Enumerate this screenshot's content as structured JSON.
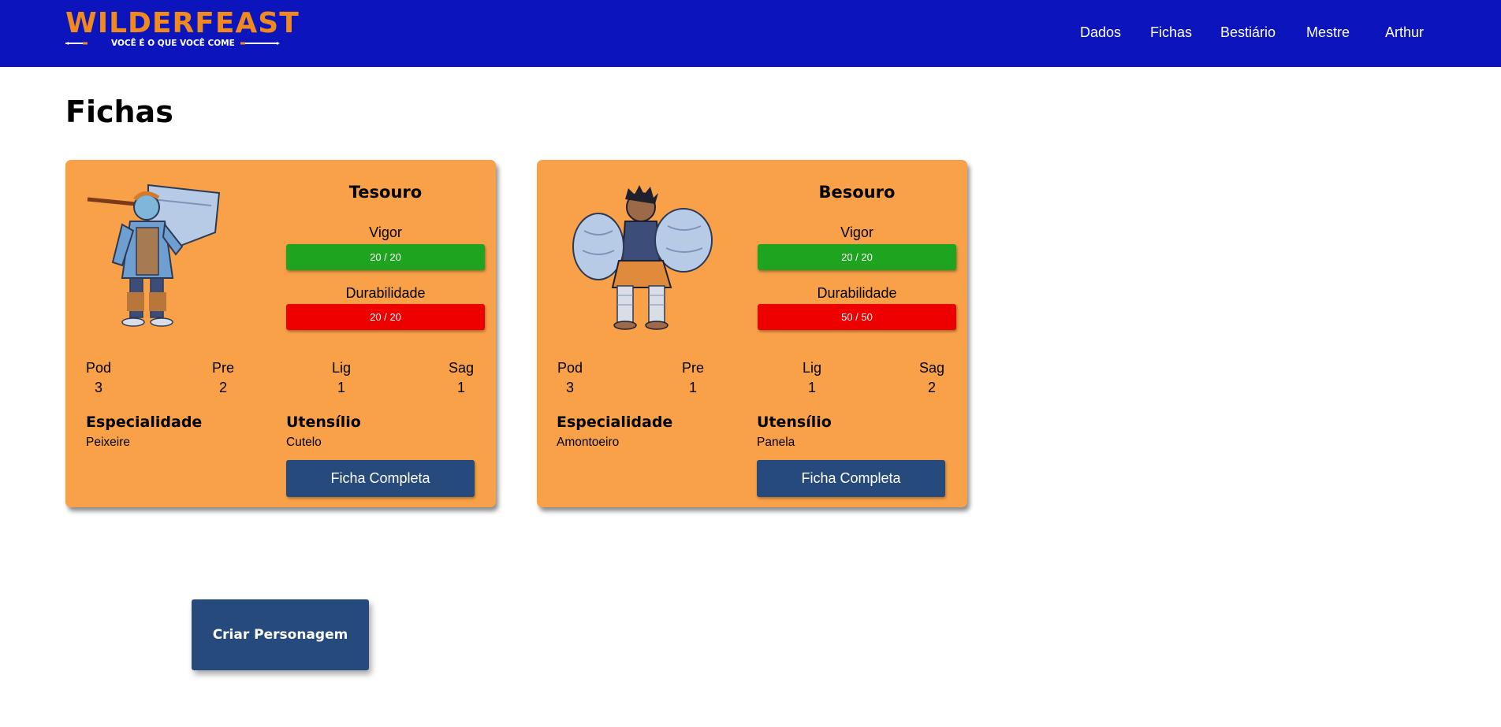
{
  "header": {
    "logo_title": "WILDERFEAST",
    "logo_tagline": "VOCÊ É O QUE VOCÊ COME",
    "nav": [
      {
        "label": "Dados"
      },
      {
        "label": "Fichas"
      },
      {
        "label": "Bestiário"
      },
      {
        "label": "Mestre"
      },
      {
        "label": "Arthur"
      }
    ]
  },
  "page": {
    "title": "Fichas",
    "create_button": "Criar Personagem"
  },
  "colors": {
    "navbar": "#0b15bb",
    "logo_orange": "#f08a1f",
    "card_bg": "#f8a148",
    "vigor_bar": "#1ea41e",
    "durabilidade_bar": "#ef0000",
    "button_blue": "#274a7c"
  },
  "cards": [
    {
      "name": "Tesouro",
      "portrait_icon": "cleaver-warrior-portrait",
      "vigor_label": "Vigor",
      "vigor_value": "20 / 20",
      "vigor_fraction": 1.0,
      "durabilidade_label": "Durabilidade",
      "durabilidade_value": "20 / 20",
      "durabilidade_fraction": 1.0,
      "stats": [
        {
          "name": "Pod",
          "value": "3"
        },
        {
          "name": "Pre",
          "value": "2"
        },
        {
          "name": "Lig",
          "value": "1"
        },
        {
          "name": "Sag",
          "value": "1"
        }
      ],
      "especialidade_label": "Especialidade",
      "especialidade": "Peixeire",
      "utensilio_label": "Utensílio",
      "utensilio": "Cutelo",
      "button": "Ficha Completa"
    },
    {
      "name": "Besouro",
      "portrait_icon": "pillow-brawler-portrait",
      "vigor_label": "Vigor",
      "vigor_value": "20 / 20",
      "vigor_fraction": 1.0,
      "durabilidade_label": "Durabilidade",
      "durabilidade_value": "50 / 50",
      "durabilidade_fraction": 1.0,
      "stats": [
        {
          "name": "Pod",
          "value": "3"
        },
        {
          "name": "Pre",
          "value": "1"
        },
        {
          "name": "Lig",
          "value": "1"
        },
        {
          "name": "Sag",
          "value": "2"
        }
      ],
      "especialidade_label": "Especialidade",
      "especialidade": "Amontoeiro",
      "utensilio_label": "Utensílio",
      "utensilio": "Panela",
      "button": "Ficha Completa"
    }
  ]
}
